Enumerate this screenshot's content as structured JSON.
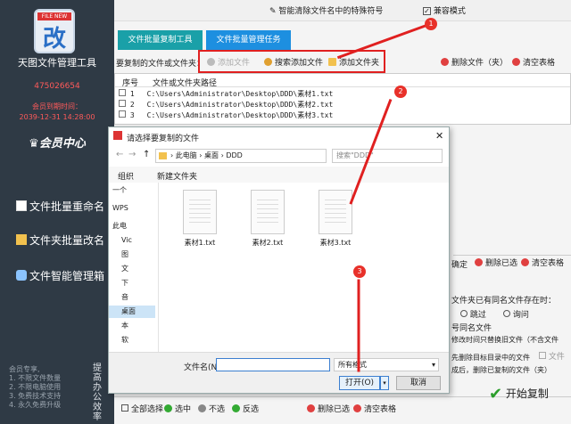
{
  "sidebar": {
    "app_name": "天图文件管理工具",
    "qq": "475026654",
    "member_time_label": "会员到期时间：",
    "member_time": "2039-12-31 14:28:00",
    "member_center": "会员中心",
    "items": [
      {
        "label": "文件批量重命名"
      },
      {
        "label": "文件夹批量改名"
      },
      {
        "label": "文件智能管理箱"
      }
    ],
    "promo_lines": [
      "会员专享,",
      "1. 不限文件数量",
      "2. 不限电脑使用",
      "3. 免费技术支持",
      "4. 永久免费升级"
    ],
    "promo_side": "提高办公效率",
    "logo_ribbon": "FILE NEW"
  },
  "topbar": {
    "clear_special": "智能清除文件名中的特殊符号",
    "compat_mode": "兼容模式"
  },
  "tabs": [
    {
      "label": "文件批量复制工具"
    },
    {
      "label": "文件批量管理任务"
    }
  ],
  "toolbar": {
    "label": "要复制的文件或文件夹：",
    "add_file": "添加文件",
    "search_add": "搜索添加文件",
    "add_folder": "添加文件夹",
    "delete_files": "删除文件（夹）",
    "clear_table": "清空表格"
  },
  "table": {
    "col_index": "序号",
    "col_path": "文件或文件夹路径",
    "rows": [
      {
        "index": "1",
        "path": "C:\\Users\\Administrator\\Desktop\\DDD\\素材1.txt"
      },
      {
        "index": "2",
        "path": "C:\\Users\\Administrator\\Desktop\\DDD\\素材2.txt"
      },
      {
        "index": "3",
        "path": "C:\\Users\\Administrator\\Desktop\\DDD\\素材3.txt"
      }
    ]
  },
  "right_panel": {
    "confirm": "确定",
    "delete_selected": "删除已选",
    "clear_table": "清空表格",
    "conflict_title": "文件夹已有同名文件存在时：",
    "skip": "跳过",
    "ask": "询问",
    "same_name": "号同名文件",
    "modify_time": "修改时间只替换旧文件（不含文件",
    "folder": "文件",
    "delete_line1": "先删除目标目录中的文件",
    "delete_line2": "成后，删除已复制的文件（夹）"
  },
  "bottom": {
    "select_all": "全部选择",
    "select": "选中",
    "unselect": "不选",
    "invert": "反选",
    "delete_selected": "删除已选",
    "clear_table": "清空表格",
    "start_copy": "开始复制"
  },
  "dialog": {
    "title": "请选择要复制的文件",
    "breadcrumb": [
      "此电脑",
      "桌面",
      "DDD"
    ],
    "search_placeholder": "搜索\"DDD\"",
    "organize": "组织",
    "new_folder": "新建文件夹",
    "nav": [
      "一个",
      "WPS",
      "此电",
      "Vic",
      "图",
      "文",
      "下",
      "音",
      "桌面",
      "本",
      "软"
    ],
    "files": [
      "素材1.txt",
      "素材2.txt",
      "素材3.txt"
    ],
    "filename_label": "文件名(N):",
    "filetype": "所有格式",
    "open": "打开(O)",
    "cancel": "取消"
  },
  "badges": [
    "1",
    "2",
    "3"
  ],
  "colors": {
    "sidebar_bg": "#2f3a45",
    "tab_inactive": "#1aa0a8",
    "tab_active": "#1d8fe0",
    "annotation_red": "#e02020",
    "red_text": "#ff5a5a"
  }
}
